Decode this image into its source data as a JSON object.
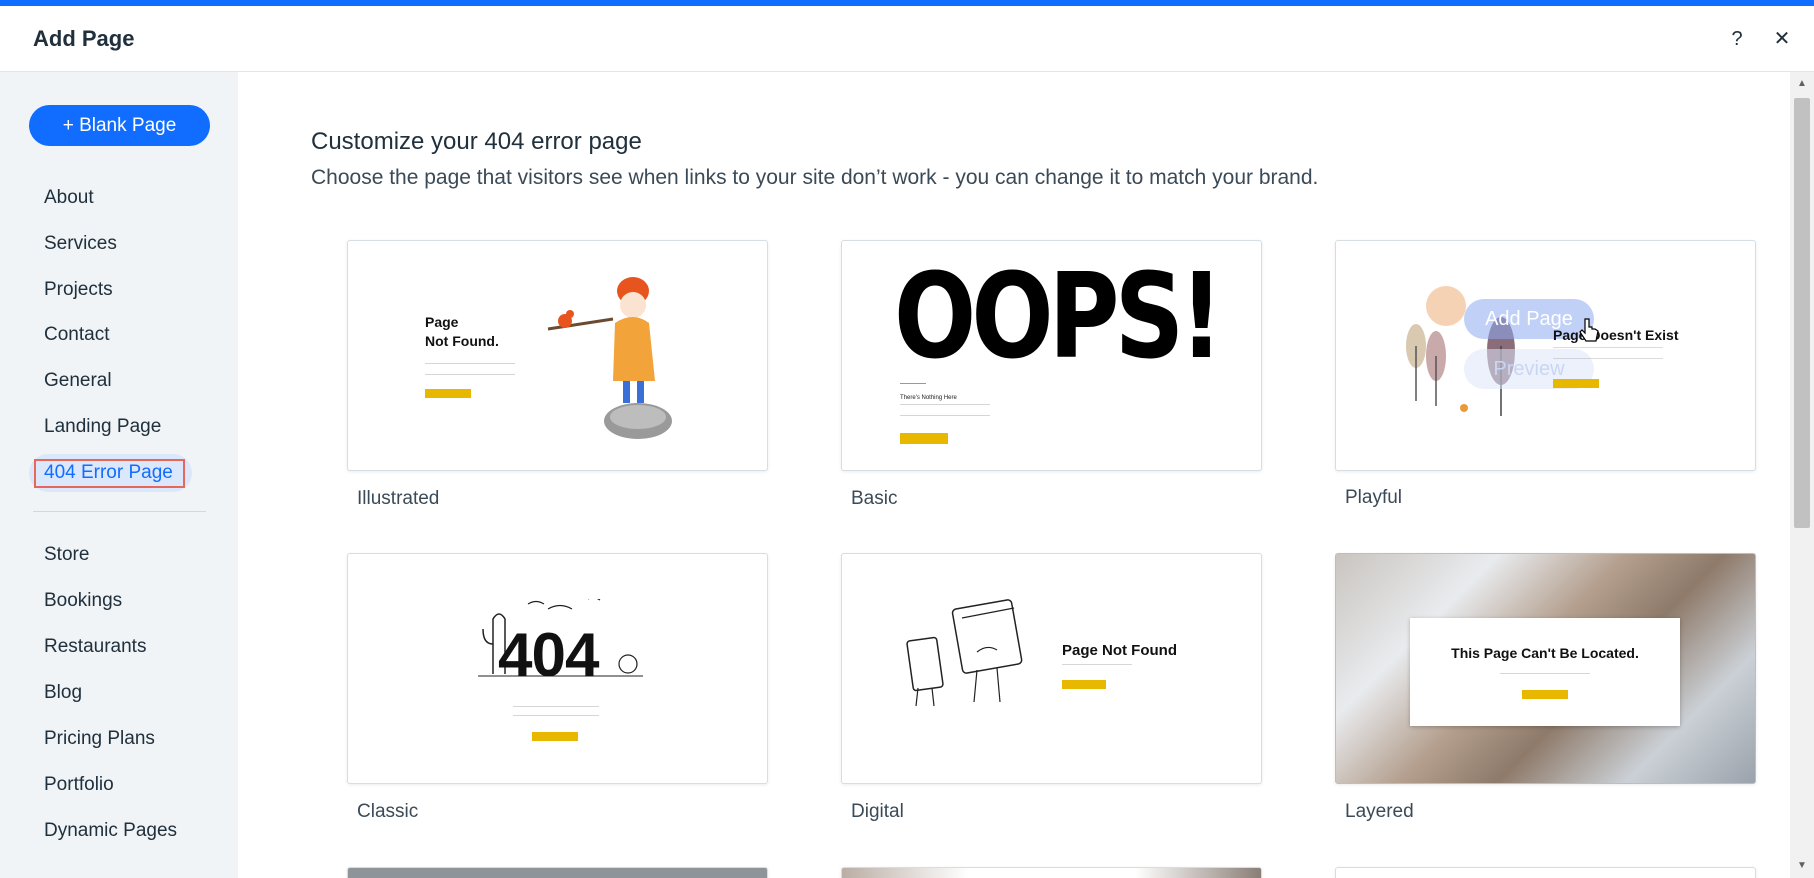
{
  "header": {
    "title": "Add Page",
    "help_icon": "?",
    "close_icon": "✕"
  },
  "sidebar": {
    "blank_page_label": "+ Blank Page",
    "primary_items": [
      {
        "label": "About"
      },
      {
        "label": "Services"
      },
      {
        "label": "Projects"
      },
      {
        "label": "Contact"
      },
      {
        "label": "General"
      },
      {
        "label": "Landing Page"
      },
      {
        "label": "404 Error Page"
      }
    ],
    "secondary_items": [
      {
        "label": "Store"
      },
      {
        "label": "Bookings"
      },
      {
        "label": "Restaurants"
      },
      {
        "label": "Blog"
      },
      {
        "label": "Pricing Plans"
      },
      {
        "label": "Portfolio"
      },
      {
        "label": "Dynamic Pages"
      }
    ]
  },
  "main": {
    "heading": "Customize your 404 error page",
    "subheading": "Choose the page that visitors see when links to your site don’t work - you can change it to match your brand.",
    "templates": [
      {
        "label": "Illustrated",
        "preview_title": "Page\nNot Found."
      },
      {
        "label": "Basic",
        "preview_title": "OOPS!",
        "preview_sub": "There's Nothing Here"
      },
      {
        "label": "Playful",
        "preview_title": "Page Doesn't Exist",
        "hover_add": "Add Page",
        "hover_preview": "Preview"
      },
      {
        "label": "Classic",
        "preview_title": "404"
      },
      {
        "label": "Digital",
        "preview_title": "Page Not Found"
      },
      {
        "label": "Layered",
        "preview_title": "This Page Can't Be Located."
      }
    ]
  },
  "colors": {
    "accent": "#116dff",
    "active_bg": "#dbe7fb",
    "highlight_border": "#e8675b",
    "template_button": "#e8b800"
  }
}
